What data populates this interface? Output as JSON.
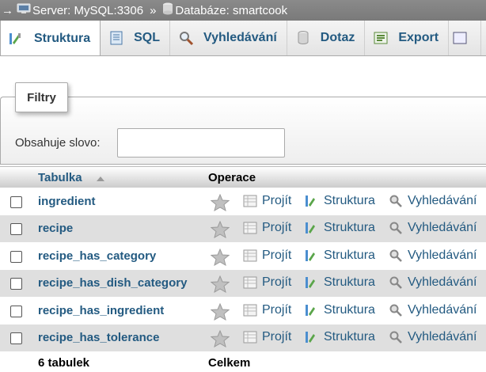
{
  "breadcrumb": {
    "arrow": "→",
    "server": "Server: MySQL:3306",
    "separator": "»",
    "database": "Databáze: smartcook"
  },
  "tabs": [
    {
      "label": "Struktura",
      "icon": "structure-icon",
      "active": true
    },
    {
      "label": "SQL",
      "icon": "sql-icon",
      "active": false
    },
    {
      "label": "Vyhledávání",
      "icon": "search-icon",
      "active": false
    },
    {
      "label": "Dotaz",
      "icon": "query-icon",
      "active": false
    },
    {
      "label": "Export",
      "icon": "export-icon",
      "active": false
    }
  ],
  "filter": {
    "legend": "Filtry",
    "label": "Obsahuje slovo:",
    "value": ""
  },
  "table": {
    "col_table": "Tabulka",
    "col_operations": "Operace",
    "rows": [
      {
        "name": "ingredient",
        "browse": "Projít",
        "structure": "Struktura",
        "search": "Vyhledávání"
      },
      {
        "name": "recipe",
        "browse": "Projít",
        "structure": "Struktura",
        "search": "Vyhledávání"
      },
      {
        "name": "recipe_has_category",
        "browse": "Projít",
        "structure": "Struktura",
        "search": "Vyhledávání"
      },
      {
        "name": "recipe_has_dish_category",
        "browse": "Projít",
        "structure": "Struktura",
        "search": "Vyhledávání"
      },
      {
        "name": "recipe_has_ingredient",
        "browse": "Projít",
        "structure": "Struktura",
        "search": "Vyhledávání"
      },
      {
        "name": "recipe_has_tolerance",
        "browse": "Projít",
        "structure": "Struktura",
        "search": "Vyhledávání"
      }
    ],
    "footer_count": "6 tabulek",
    "footer_total": "Celkem"
  },
  "colors": {
    "link": "#235a81",
    "breadcrumb_bg": "#808080",
    "row_alt": "#dfdfdf"
  }
}
